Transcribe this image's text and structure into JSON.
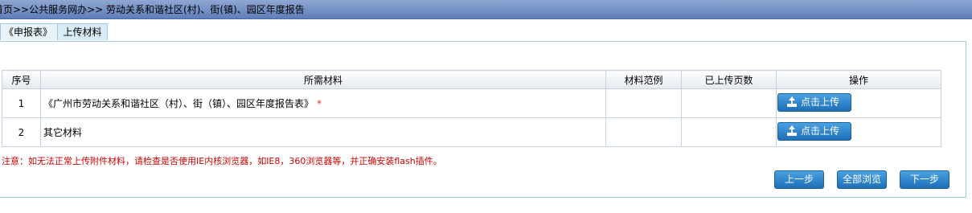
{
  "breadcrumb": "首页>>公共服务网办>> 劳动关系和谐社区(村)、街(镇)、园区年度报告",
  "tabs": [
    {
      "label": "《申报表》"
    },
    {
      "label": "上传材料"
    }
  ],
  "table": {
    "headers": [
      "序号",
      "所需材料",
      "材料范例",
      "已上传页数",
      "操作"
    ],
    "rows": [
      {
        "index": "1",
        "material": "《广州市劳动关系和谐社区（村）、街（镇）、园区年度报告表》",
        "required_mark": "*",
        "sample": "",
        "uploaded": "",
        "action": "点击上传"
      },
      {
        "index": "2",
        "material": "其它材料",
        "required_mark": "",
        "sample": "",
        "uploaded": "",
        "action": "点击上传"
      }
    ]
  },
  "note": "注意：如无法正常上传附件材料，请检查是否使用IE内核浏览器，如IE8，360浏览器等，并正确安装flash插件。",
  "buttons": {
    "prev": "上一步",
    "browse_all": "全部浏览",
    "next": "下一步"
  },
  "colors": {
    "button_blue": "#1f6fb7",
    "note_red": "#cc0000",
    "titlebar": "#6f8cc4"
  },
  "icons": [
    "upload-icon"
  ]
}
